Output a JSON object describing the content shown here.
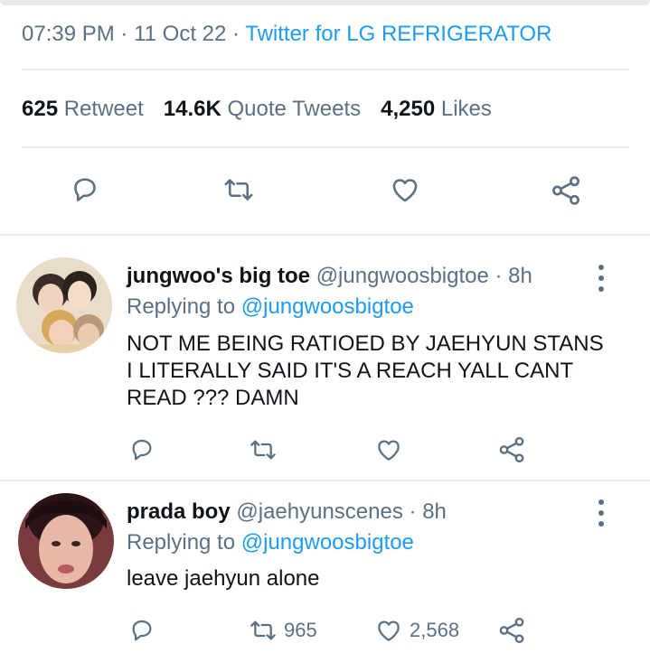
{
  "tweet": {
    "time": "07:39 PM",
    "date": "11 Oct 22",
    "source": "Twitter for LG REFRIGERATOR",
    "retweets": {
      "count": "625",
      "label": "Retweet"
    },
    "quotes": {
      "count": "14.6K",
      "label": "Quote Tweets"
    },
    "likes": {
      "count": "4,250",
      "label": "Likes"
    },
    "actions": [
      "reply-icon",
      "retweet-icon",
      "like-icon",
      "share-icon"
    ]
  },
  "replies": [
    {
      "display_name": "jungwoo's big toe",
      "handle": "@jungwoosbigtoe",
      "age": "8h",
      "replying_label": "Replying to",
      "replying_to": "@jungwoosbigtoe",
      "lines": [
        "NOT ME BEING RATIOED BY  JAEHYUN STANS",
        "I LITERALLY SAID IT'S A REACH YALL CANT",
        "READ  ??? DAMN"
      ],
      "retweet_count": "",
      "like_count": ""
    },
    {
      "display_name": "prada boy",
      "handle": "@jaehyunscenes",
      "age": "8h",
      "replying_label": "Replying to",
      "replying_to": "@jungwoosbigtoe",
      "lines": [
        "leave jaehyun alone"
      ],
      "retweet_count": "965",
      "like_count": "2,568"
    }
  ],
  "colors": {
    "secondary_text": "#5b7083",
    "link": "#1d9bf0",
    "primary_text": "#0f1419",
    "divider": "#e6ecf0"
  }
}
